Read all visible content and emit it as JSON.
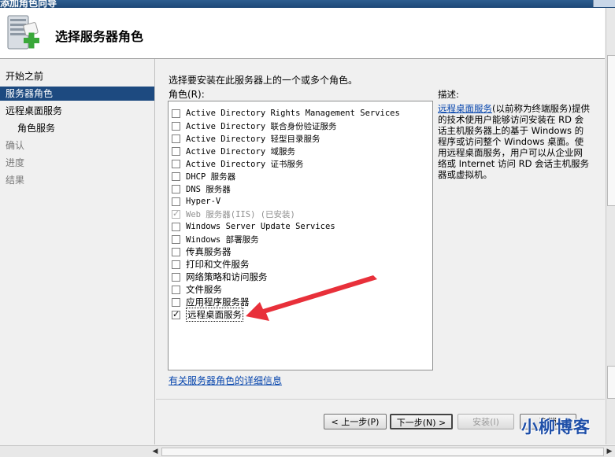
{
  "window": {
    "title": "添加角色向导"
  },
  "header": {
    "page_title": "选择服务器角色",
    "icon": "server-add-icon"
  },
  "nav": {
    "items": [
      {
        "label": "开始之前",
        "state": "normal"
      },
      {
        "label": "服务器角色",
        "state": "active"
      },
      {
        "label": "远程桌面服务",
        "state": "normal"
      },
      {
        "label": "角色服务",
        "state": "sub"
      },
      {
        "label": "确认",
        "state": "disabled"
      },
      {
        "label": "进度",
        "state": "disabled"
      },
      {
        "label": "结果",
        "state": "disabled"
      }
    ]
  },
  "main": {
    "instruction": "选择要安装在此服务器上的一个或多个角色。",
    "roles_label": "角色(R):",
    "roles": [
      {
        "label": "Active Directory Rights Management Services",
        "checked": false
      },
      {
        "label": "Active Directory 联合身份验证服务",
        "checked": false
      },
      {
        "label": "Active Directory 轻型目录服务",
        "checked": false
      },
      {
        "label": "Active Directory 域服务",
        "checked": false
      },
      {
        "label": "Active Directory 证书服务",
        "checked": false
      },
      {
        "label": "DHCP 服务器",
        "checked": false
      },
      {
        "label": "DNS 服务器",
        "checked": false
      },
      {
        "label": "Hyper-V",
        "checked": false
      },
      {
        "label": "Web 服务器(IIS)  (已安装)",
        "checked": true,
        "disabled": true
      },
      {
        "label": "Windows Server Update Services",
        "checked": false
      },
      {
        "label": "Windows 部署服务",
        "checked": false
      },
      {
        "label": "传真服务器",
        "checked": false
      },
      {
        "label": "打印和文件服务",
        "checked": false
      },
      {
        "label": "网络策略和访问服务",
        "checked": false
      },
      {
        "label": "文件服务",
        "checked": false
      },
      {
        "label": "应用程序服务器",
        "checked": false
      },
      {
        "label": "远程桌面服务",
        "checked": true,
        "selected": true
      }
    ],
    "description": {
      "heading": "描述:",
      "link": "远程桌面服务",
      "text": "(以前称为终端服务)提供的技术使用户能够访问安装在 RD 会话主机服务器上的基于 Windows 的程序或访问整个 Windows 桌面。使用远程桌面服务，用户可以从企业网络或 Internet 访问 RD 会话主机服务器或虚拟机。"
    },
    "more_info_link": "有关服务器角色的详细信息"
  },
  "buttons": {
    "prev": "< 上一步(P)",
    "next": "下一步(N) >",
    "install": "安装(I)",
    "cancel": "取消"
  },
  "watermark": "小柳博客",
  "annotation": {
    "color": "#e8303a"
  }
}
